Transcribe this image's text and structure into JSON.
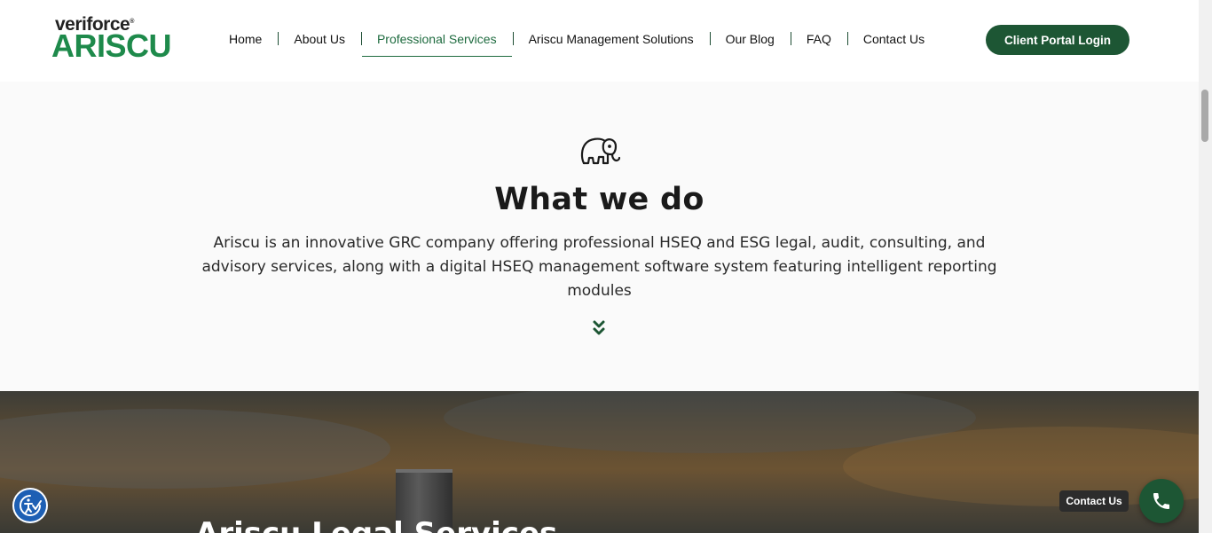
{
  "brand": {
    "top": "veriforce",
    "top_mark": "®",
    "bottom": "ARISCU"
  },
  "nav": {
    "items": [
      {
        "label": "Home"
      },
      {
        "label": "About Us"
      },
      {
        "label": "Professional Services",
        "active": true
      },
      {
        "label": "Ariscu Management Solutions"
      },
      {
        "label": "Our Blog"
      },
      {
        "label": "FAQ"
      },
      {
        "label": "Contact Us"
      }
    ]
  },
  "portal_button": {
    "label": "Client Portal Login"
  },
  "what_we_do": {
    "icon": "elephant-icon",
    "title": "What we do",
    "description": "Ariscu is an innovative GRC company offering professional HSEQ and ESG legal, audit, consulting, and advisory services, along with a digital HSEQ management software system featuring intelligent reporting modules",
    "scroll_icon": "double-chevron-down-icon"
  },
  "hero": {
    "title": "Ariscu Legal Services"
  },
  "widgets": {
    "accessibility_icon": "accessibility-icon",
    "contact_label": "Contact Us",
    "phone_icon": "phone-icon"
  },
  "colors": {
    "brand_green": "#1e8a4b",
    "dark_green": "#1d5634",
    "accessibility_blue": "#1d5fb4"
  }
}
